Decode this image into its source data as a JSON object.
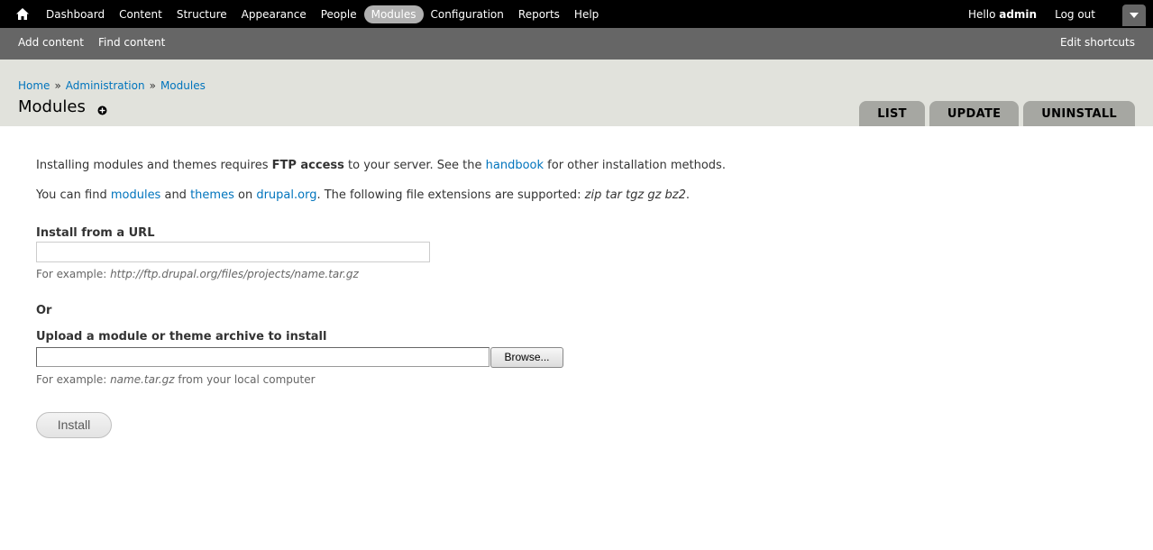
{
  "toolbar": {
    "nav": [
      {
        "label": "Dashboard"
      },
      {
        "label": "Content"
      },
      {
        "label": "Structure"
      },
      {
        "label": "Appearance"
      },
      {
        "label": "People"
      },
      {
        "label": "Modules",
        "active": true
      },
      {
        "label": "Configuration"
      },
      {
        "label": "Reports"
      },
      {
        "label": "Help"
      }
    ],
    "hello_prefix": "Hello ",
    "username": "admin",
    "logout": "Log out"
  },
  "shortcuts": {
    "items": [
      "Add content",
      "Find content"
    ],
    "edit": "Edit shortcuts"
  },
  "header": {
    "breadcrumb": [
      "Home",
      "Administration",
      "Modules"
    ],
    "breadcrumb_separator": "»",
    "title": "Modules",
    "tabs": [
      "LIST",
      "UPDATE",
      "UNINSTALL"
    ]
  },
  "intro": {
    "p1_a": "Installing modules and themes requires ",
    "p1_bold": "FTP access",
    "p1_b": " to your server. See the ",
    "p1_link": "handbook",
    "p1_c": " for other installation methods.",
    "p2_a": "You can find ",
    "p2_link_modules": "modules",
    "p2_b": " and ",
    "p2_link_themes": "themes",
    "p2_c": " on ",
    "p2_link_drupal": "drupal.org",
    "p2_d": ". The following file extensions are supported: ",
    "p2_ext": "zip tar tgz gz bz2",
    "p2_e": "."
  },
  "form": {
    "url_label": "Install from a URL",
    "url_value": "",
    "url_desc_prefix": "For example: ",
    "url_desc_example": "http://ftp.drupal.org/files/projects/name.tar.gz",
    "or_label": "Or",
    "upload_label": "Upload a module or theme archive to install",
    "browse_label": "Browse...",
    "upload_desc_prefix": "For example: ",
    "upload_desc_example": "name.tar.gz",
    "upload_desc_suffix": " from your local computer",
    "install_label": "Install"
  },
  "colors": {
    "toolbar_bg": "#000000",
    "shortcuts_bg": "#666666",
    "header_bg": "#e1e2dc",
    "tab_bg": "#a6a7a2",
    "link": "#0074bd"
  }
}
